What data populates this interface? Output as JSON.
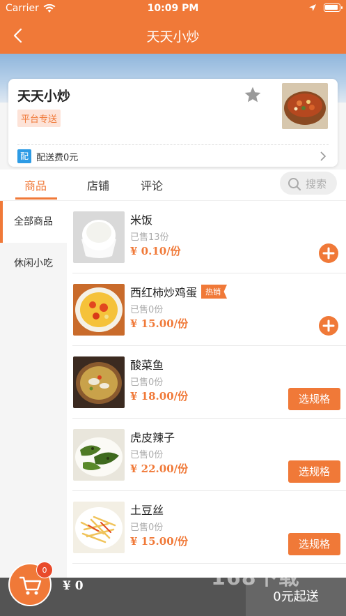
{
  "status_bar": {
    "carrier": "Carrier",
    "time": "10:09 PM"
  },
  "nav": {
    "title": "天天小炒"
  },
  "shop": {
    "name": "天天小炒",
    "tag": "平台专送",
    "delivery_badge": "配",
    "delivery_fee": "配送费0元"
  },
  "tabs": [
    {
      "label": "商品",
      "active": true
    },
    {
      "label": "店铺",
      "active": false
    },
    {
      "label": "评论",
      "active": false
    }
  ],
  "search": {
    "placeholder": "搜索"
  },
  "categories": [
    {
      "label": "全部商品",
      "active": true
    },
    {
      "label": "休闲小吃",
      "active": false
    }
  ],
  "products": [
    {
      "name": "米饭",
      "sold": "已售13份",
      "price": "¥ 0.10/份",
      "hot": "",
      "action": "add"
    },
    {
      "name": "西红柿炒鸡蛋",
      "sold": "已售0份",
      "price": "¥ 15.00/份",
      "hot": "热销",
      "action": "add"
    },
    {
      "name": "酸菜鱼",
      "sold": "已售0份",
      "price": "¥ 18.00/份",
      "hot": "",
      "action": "spec",
      "action_label": "选规格"
    },
    {
      "name": "虎皮辣子",
      "sold": "已售0份",
      "price": "¥ 22.00/份",
      "hot": "",
      "action": "spec",
      "action_label": "选规格"
    },
    {
      "name": "土豆丝",
      "sold": "已售0份",
      "price": "¥ 15.00/份",
      "hot": "",
      "action": "spec",
      "action_label": "选规格"
    }
  ],
  "cart": {
    "count": "0",
    "total": "¥ 0",
    "checkout_label": "0元起送"
  },
  "watermark": "168下载",
  "colors": {
    "accent": "#f07938",
    "delivery_badge": "#2d9be5",
    "bottom_bar": "#545454"
  }
}
